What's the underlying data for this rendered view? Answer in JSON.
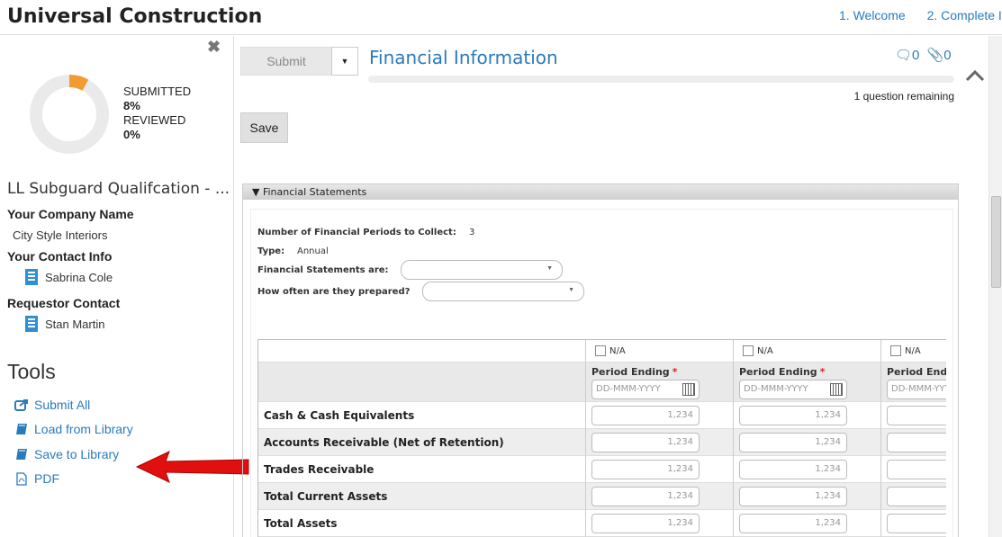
{
  "app": {
    "title": "Universal Construction"
  },
  "steps": [
    "1. Welcome",
    "2. Complete I"
  ],
  "sidebar": {
    "submitted_label": "SUBMITTED",
    "submitted_value": "8%",
    "submitted_fraction": 0.08,
    "reviewed_label": "REVIEWED",
    "reviewed_value": "0%",
    "questionnaire_title": "LL Subguard Qualifcation - ...",
    "company_heading": "Your Company Name",
    "company_name": "City Style Interiors",
    "contact_heading": "Your Contact Info",
    "contact_name": "Sabrina Cole",
    "requestor_heading": "Requestor Contact",
    "requestor_name": "Stan Martin",
    "tools_heading": "Tools",
    "tools": [
      {
        "label": "Submit All",
        "icon": "share-icon"
      },
      {
        "label": "Load from Library",
        "icon": "book-icon"
      },
      {
        "label": "Save to Library",
        "icon": "book-icon"
      },
      {
        "label": "PDF",
        "icon": "pdf-icon"
      }
    ]
  },
  "main": {
    "submit_label": "Submit",
    "section_title": "Financial Information",
    "comments_count": "0",
    "attachments_count": "0",
    "remaining": "1 question remaining",
    "save_label": "Save",
    "panel_title": "Financial Statements",
    "periods_label": "Number of Financial Periods to Collect:",
    "periods_value": "3",
    "type_label": "Type:",
    "type_value": "Annual",
    "statements_label": "Financial Statements are:",
    "statements_value": "",
    "prepared_label": "How often are they prepared?",
    "prepared_value": ""
  },
  "table": {
    "na_label": "N/A",
    "period_label": "Period Ending",
    "required_mark": "*",
    "date_placeholder": "DD-MMM-YYYY",
    "amount_placeholder": "1,234",
    "rows": [
      "Cash & Cash Equivalents",
      "Accounts Receivable (Net of Retention)",
      "Trades Receivable",
      "Total Current Assets",
      "Total Assets"
    ]
  },
  "colors": {
    "accent": "#2a7bbd",
    "donut_progress": "#f29b30",
    "arrow": "#e01010"
  }
}
